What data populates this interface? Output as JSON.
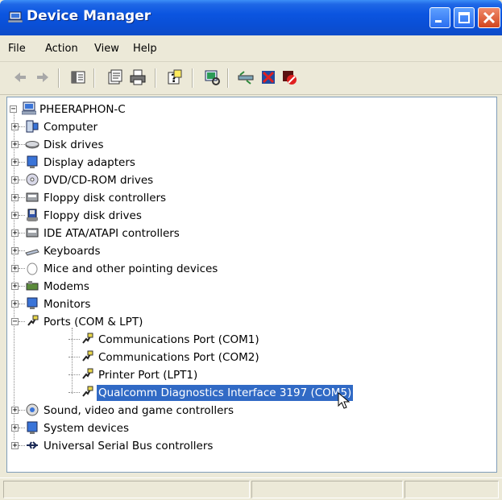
{
  "window": {
    "title": "Device Manager"
  },
  "menu": [
    "File",
    "Action",
    "View",
    "Help"
  ],
  "toolbar": {
    "icons": [
      "back-arrow-icon",
      "forward-arrow-icon",
      "show-hide-tree-icon",
      "properties-icon",
      "print-icon",
      "help-icon",
      "scan-hardware-icon",
      "update-driver-icon",
      "uninstall-icon",
      "disable-icon"
    ]
  },
  "tree": {
    "root": "PHEERAPHON-C",
    "categories": [
      {
        "label": "Computer",
        "icon": "computer-icon"
      },
      {
        "label": "Disk drives",
        "icon": "disk-drive-icon"
      },
      {
        "label": "Display adapters",
        "icon": "display-adapter-icon"
      },
      {
        "label": "DVD/CD-ROM drives",
        "icon": "cdrom-icon"
      },
      {
        "label": "Floppy disk controllers",
        "icon": "floppy-controller-icon"
      },
      {
        "label": "Floppy disk drives",
        "icon": "floppy-drive-icon"
      },
      {
        "label": "IDE ATA/ATAPI controllers",
        "icon": "ide-controller-icon"
      },
      {
        "label": "Keyboards",
        "icon": "keyboard-icon"
      },
      {
        "label": "Mice and other pointing devices",
        "icon": "mouse-icon"
      },
      {
        "label": "Modems",
        "icon": "modem-icon"
      },
      {
        "label": "Monitors",
        "icon": "monitor-icon"
      },
      {
        "label": "Ports (COM & LPT)",
        "icon": "port-icon"
      }
    ],
    "ports_children": [
      "Communications Port (COM1)",
      "Communications Port (COM2)",
      "Printer Port (LPT1)",
      "Qualcomm Diagnostics Interface 3197 (COM5)"
    ],
    "after_categories": [
      {
        "label": "Sound, video and game controllers",
        "icon": "sound-icon"
      },
      {
        "label": "System devices",
        "icon": "system-devices-icon"
      },
      {
        "label": "Universal Serial Bus controllers",
        "icon": "usb-icon"
      }
    ],
    "selected": "Qualcomm Diagnostics Interface 3197 (COM5)"
  },
  "colors": {
    "selection": "#316ac5",
    "titlebar": "#0a4fd6"
  }
}
